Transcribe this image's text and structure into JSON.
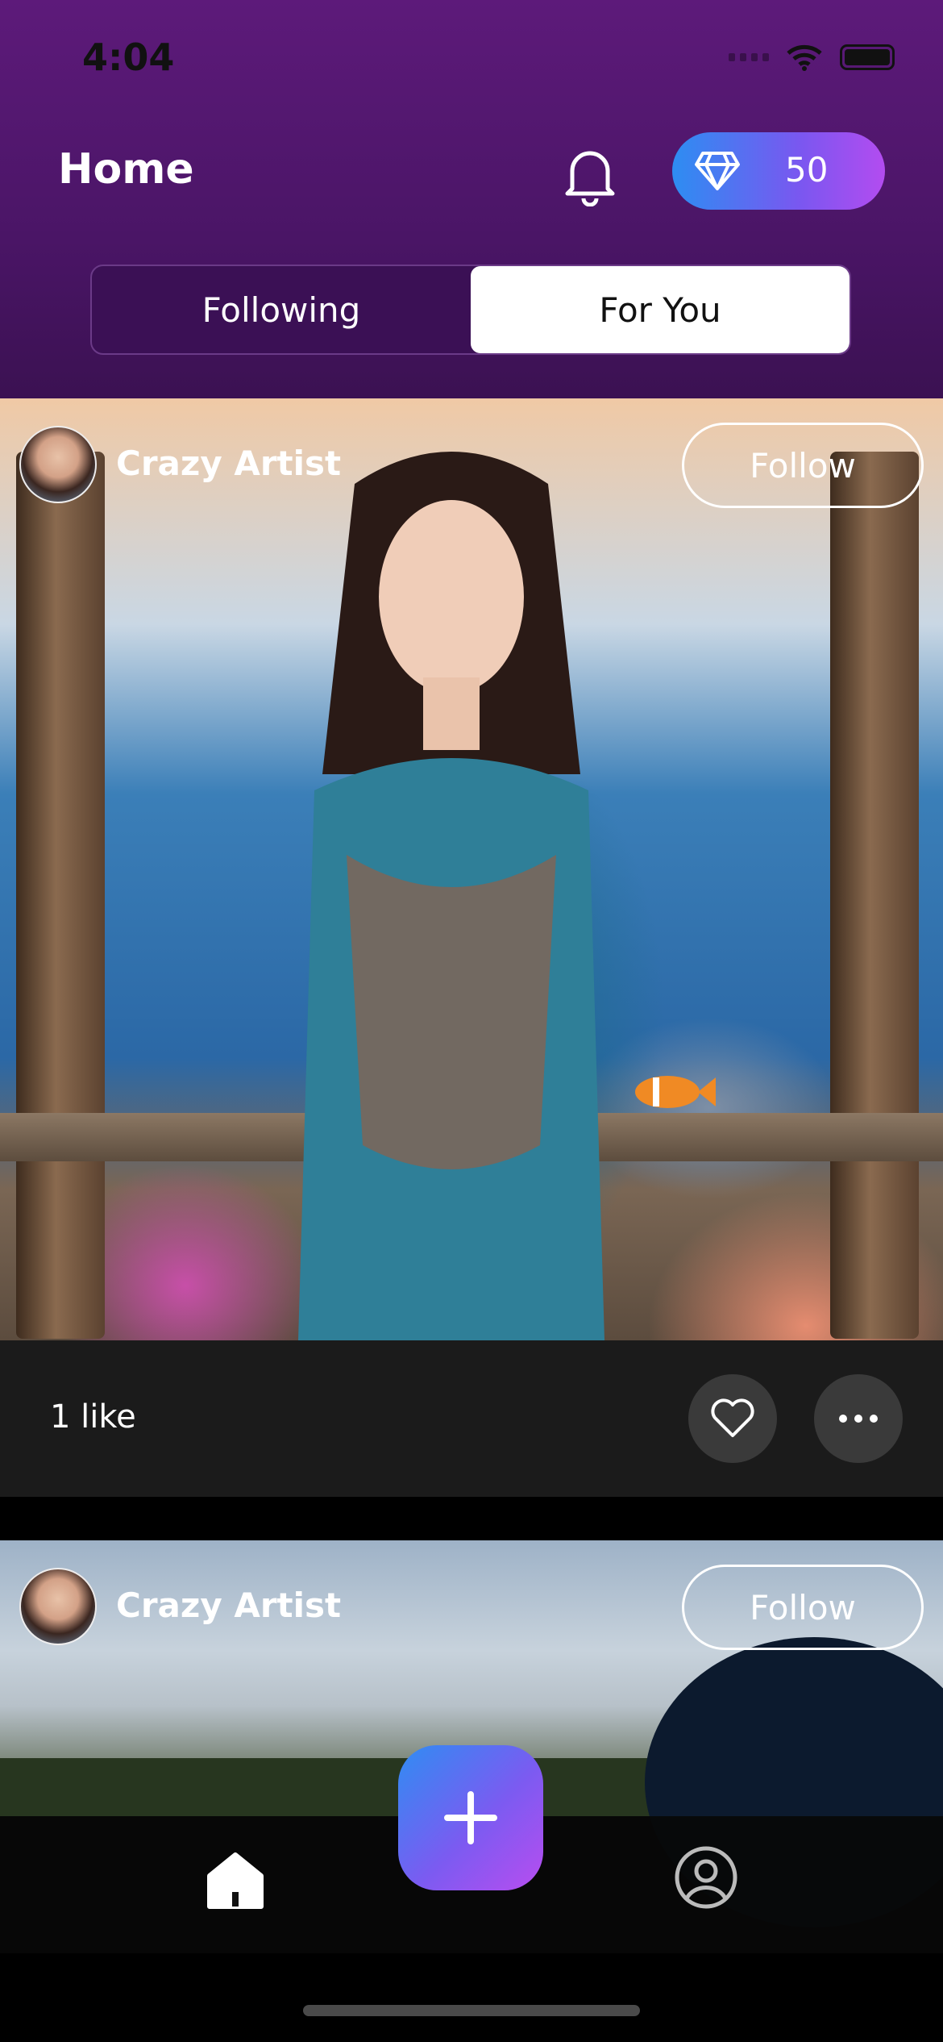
{
  "status_bar": {
    "time": "4:04"
  },
  "header": {
    "title": "Home",
    "gems_count": "50",
    "bell_icon": "bell-icon",
    "gem_icon": "diamond-icon"
  },
  "tabs": [
    {
      "label": "Following",
      "active": false
    },
    {
      "label": "For You",
      "active": true
    }
  ],
  "posts": [
    {
      "author": "Crazy Artist",
      "follow_label": "Follow",
      "likes": "1 like"
    },
    {
      "author": "Crazy Artist",
      "follow_label": "Follow"
    }
  ],
  "nav": {
    "home_icon": "home-icon",
    "add_icon": "plus-icon",
    "profile_icon": "profile-icon"
  },
  "colors": {
    "header_purple": "#5d1a7a",
    "accent_blue": "#2d8df2",
    "accent_violet": "#b34cf0"
  }
}
